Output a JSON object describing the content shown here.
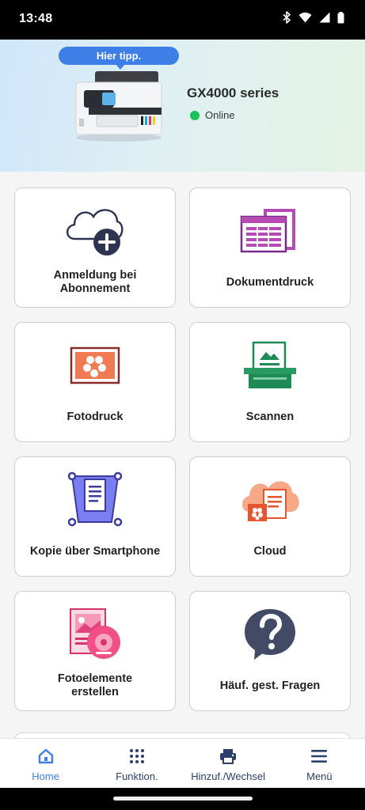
{
  "status_bar": {
    "time": "13:48",
    "icons": [
      "bluetooth-icon",
      "wifi-icon",
      "signal-icon",
      "battery-icon"
    ]
  },
  "header": {
    "tip": "Hier tipp.",
    "printer_name": "GX4000 series",
    "printer_status": "Online",
    "status_color": "#1dbf5b"
  },
  "tiles": [
    {
      "label": "Anmeldung bei\nAbonnement",
      "icon": "cloud-add-icon"
    },
    {
      "label": "Dokumentdruck",
      "icon": "document-print-icon"
    },
    {
      "label": "Fotodruck",
      "icon": "photo-print-icon"
    },
    {
      "label": "Scannen",
      "icon": "scanner-icon"
    },
    {
      "label": "Kopie über Smartphone",
      "icon": "smartphone-copy-icon"
    },
    {
      "label": "Cloud",
      "icon": "cloud-icon"
    },
    {
      "label": "Fotoelemente\nerstellen",
      "icon": "photo-elements-icon"
    },
    {
      "label": "Häuf. gest. Fragen",
      "icon": "faq-icon"
    }
  ],
  "bottom_nav": [
    {
      "label": "Home",
      "icon": "home-icon",
      "active": true
    },
    {
      "label": "Funktion.",
      "icon": "grid-icon",
      "active": false
    },
    {
      "label": "Hinzuf./Wechsel",
      "icon": "printer-icon",
      "active": false
    },
    {
      "label": "Menü",
      "icon": "hamburger-menu-icon",
      "active": false
    }
  ],
  "colors": {
    "accent": "#3d7fe6",
    "nav_text": "#2c3e6b",
    "online": "#1dbf5b"
  }
}
